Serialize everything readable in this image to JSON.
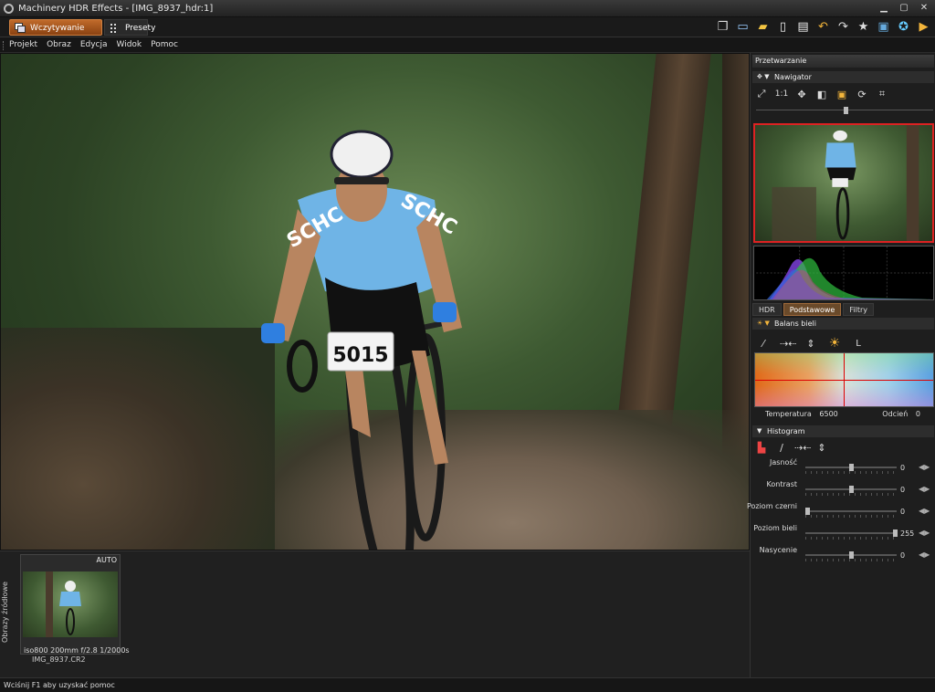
{
  "window": {
    "title": "Machinery HDR Effects - [IMG_8937_hdr:1]"
  },
  "toolbar": {
    "load_tab": "Wczytywanie obrazów",
    "presets_tab": "Presety"
  },
  "menu": [
    "Projekt",
    "Obraz",
    "Edycja",
    "Widok",
    "Pomoc"
  ],
  "panel": {
    "title": "Przetwarzanie",
    "navigator": {
      "title": "Nawigator",
      "zoom_label": "1:1"
    },
    "tabs": [
      "HDR",
      "Podstawowe",
      "Filtry"
    ],
    "active_tab": "Podstawowe",
    "white_balance": {
      "title": "Balans bieli",
      "l_label": "L",
      "temperature_label": "Temperatura",
      "temperature": "6500",
      "tint_label": "Odcień",
      "tint": "0"
    },
    "histogram": {
      "title": "Histogram",
      "sliders": [
        {
          "label": "Jasność",
          "value": "0",
          "level": 0.5
        },
        {
          "label": "Kontrast",
          "value": "0",
          "level": 0.5
        },
        {
          "label": "Poziom czerni",
          "value": "0",
          "level": 0.0
        },
        {
          "label": "Poziom bieli",
          "value": "255",
          "level": 1.0
        },
        {
          "label": "Nasycenie",
          "value": "0",
          "level": 0.5
        }
      ]
    }
  },
  "photo": {
    "bib_number": "5015",
    "jersey_text": "SCHC"
  },
  "source_images": {
    "title": "Obrazy źródłowe",
    "thumb": {
      "badge": "AUTO",
      "meta": "iso800  200mm  f/2.8  1/2000s",
      "name": "IMG_8937.CR2"
    }
  },
  "status": "Wciśnij F1 aby uzyskać pomoc",
  "colors": {
    "accent": "#c06a2a",
    "selection": "#d22222"
  }
}
